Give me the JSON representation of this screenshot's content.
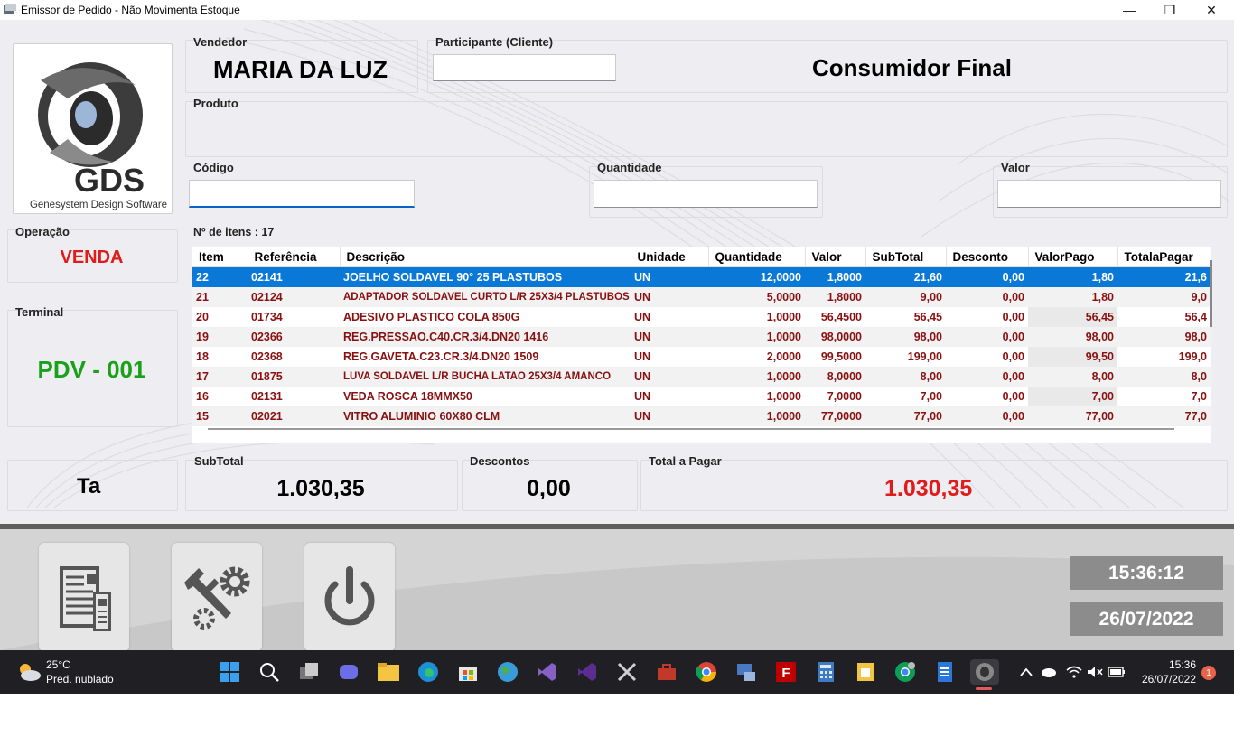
{
  "window": {
    "title": "Emissor de Pedido - Não Movimenta Estoque",
    "minimize": "—",
    "restore": "❐",
    "close": "✕"
  },
  "logo": {
    "brand": "GDS",
    "tagline": "Genesystem Design Software"
  },
  "vendedor": {
    "label": "Vendedor",
    "value": "MARIA DA LUZ"
  },
  "participante": {
    "label": "Participante (Cliente)",
    "input_value": "",
    "name": "Consumidor Final"
  },
  "produto": {
    "label": "Produto"
  },
  "codigo": {
    "label": "Código",
    "input_value": ""
  },
  "quantidade": {
    "label": "Quantidade",
    "input_value": ""
  },
  "valor": {
    "label": "Valor",
    "input_value": ""
  },
  "operacao": {
    "label": "Operação",
    "value": "VENDA"
  },
  "terminal": {
    "label": "Terminal",
    "value": "PDV - 001"
  },
  "items_count": "Nº de itens : 17",
  "table": {
    "columns": [
      "Item",
      "Referência",
      "Descrição",
      "Unidade",
      "Quantidade",
      "Valor",
      "SubTotal",
      "Desconto",
      "ValorPago",
      "TotalaPagar"
    ],
    "rows": [
      {
        "item": "22",
        "ref": "02141",
        "desc": "JOELHO SOLDAVEL 90° 25 PLASTUBOS",
        "un": "UN",
        "qtd": "12,0000",
        "valor": "1,8000",
        "subtotal": "21,60",
        "desconto": "0,00",
        "valorpago": "1,80",
        "total": "21,6"
      },
      {
        "item": "21",
        "ref": "02124",
        "desc": "ADAPTADOR SOLDAVEL CURTO L/R 25X3/4 PLASTUBOS",
        "un": "UN",
        "qtd": "5,0000",
        "valor": "1,8000",
        "subtotal": "9,00",
        "desconto": "0,00",
        "valorpago": "1,80",
        "total": "9,0"
      },
      {
        "item": "20",
        "ref": "01734",
        "desc": "ADESIVO PLASTICO COLA 850G",
        "un": "UN",
        "qtd": "1,0000",
        "valor": "56,4500",
        "subtotal": "56,45",
        "desconto": "0,00",
        "valorpago": "56,45",
        "total": "56,4"
      },
      {
        "item": "19",
        "ref": "02366",
        "desc": "REG.PRESSAO.C40.CR.3/4.DN20 1416",
        "un": "UN",
        "qtd": "1,0000",
        "valor": "98,0000",
        "subtotal": "98,00",
        "desconto": "0,00",
        "valorpago": "98,00",
        "total": "98,0"
      },
      {
        "item": "18",
        "ref": "02368",
        "desc": "REG.GAVETA.C23.CR.3/4.DN20 1509",
        "un": "UN",
        "qtd": "2,0000",
        "valor": "99,5000",
        "subtotal": "199,00",
        "desconto": "0,00",
        "valorpago": "99,50",
        "total": "199,0"
      },
      {
        "item": "17",
        "ref": "01875",
        "desc": "LUVA SOLDAVEL L/R BUCHA LATAO 25X3/4 AMANCO",
        "un": "UN",
        "qtd": "1,0000",
        "valor": "8,0000",
        "subtotal": "8,00",
        "desconto": "0,00",
        "valorpago": "8,00",
        "total": "8,0"
      },
      {
        "item": "16",
        "ref": "02131",
        "desc": "VEDA ROSCA 18MMX50",
        "un": "UN",
        "qtd": "1,0000",
        "valor": "7,0000",
        "subtotal": "7,00",
        "desconto": "0,00",
        "valorpago": "7,00",
        "total": "7,0"
      },
      {
        "item": "15",
        "ref": "02021",
        "desc": "VITRO ALUMINIO 60X80 CLM",
        "un": "UN",
        "qtd": "1,0000",
        "valor": "77,0000",
        "subtotal": "77,00",
        "desconto": "0,00",
        "valorpago": "77,00",
        "total": "77,0"
      }
    ]
  },
  "totals": {
    "ta": "Ta",
    "subtotal_label": "SubTotal",
    "subtotal": "1.030,35",
    "descontos_label": "Descontos",
    "descontos": "0,00",
    "total_label": "Total a Pagar",
    "total": "1.030,35"
  },
  "toolbar": {
    "icons": [
      "report-icon",
      "settings-tools-icon",
      "power-icon"
    ]
  },
  "clock": {
    "time": "15:36:12",
    "date": "26/07/2022"
  },
  "taskbar": {
    "weather_temp": "25°C",
    "weather_desc": "Pred. nublado",
    "time": "15:36",
    "date": "26/07/2022",
    "notifications": "1"
  },
  "colors": {
    "accent": "#0a78d7",
    "operacao": "#e01b1b",
    "terminal": "#1aa11a",
    "total": "#e01b1b",
    "row_text": "#8a1010"
  }
}
